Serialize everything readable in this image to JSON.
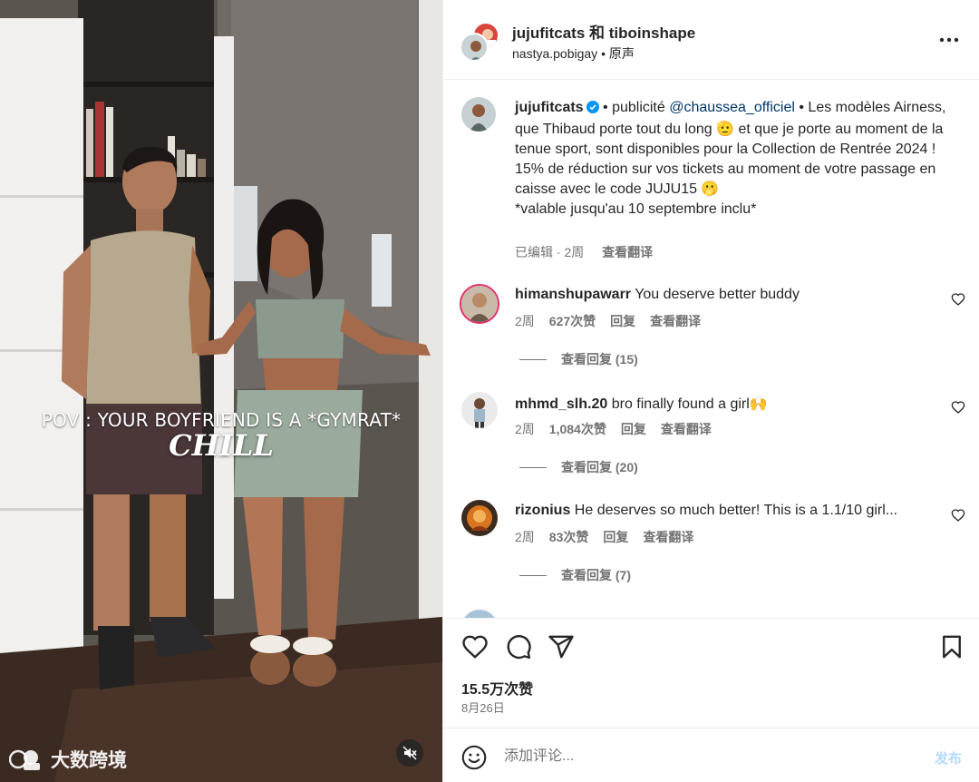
{
  "video": {
    "overlay_text": "POV : YOUR BOYFRIEND IS A *GYMRAT*",
    "overlay_title": "CHILL",
    "mute_icon": "speaker-muted-icon",
    "watermark_text": "大数跨境"
  },
  "header": {
    "user1": "jujufitcats",
    "and": "和",
    "user2": "tiboinshape",
    "audio_user": "nastya.pobigay",
    "audio_sep": " • ",
    "audio_label": "原声",
    "more_icon": "more-horizontal-icon"
  },
  "caption": {
    "username": "jujufitcats",
    "sep": " • ",
    "sponsored": "publicité",
    "mention": "@chaussea_officiel",
    "sep2": " •",
    "line1": "Les modèles Airness, que Thibaud porte tout du long 🫡 et que je porte au moment de la tenue sport, sont disponibles pour la Collection de Rentrée 2024 !",
    "line2": "15% de réduction sur vos tickets au moment de votre passage en caisse avec le code JUJU15 🫢",
    "line3": "*valable jusqu'au 10 septembre inclu*",
    "edited": "已编辑 · 2周",
    "translate": "查看翻译"
  },
  "comments": [
    {
      "username": "himanshupawarr",
      "text": "You deserve better buddy",
      "time": "2周",
      "likes": "627次赞",
      "reply": "回复",
      "translate": "查看翻译",
      "view_replies": "查看回复 (15)"
    },
    {
      "username": "mhmd_slh.20",
      "text": "bro finally found a girl🙌",
      "time": "2周",
      "likes": "1,084次赞",
      "reply": "回复",
      "translate": "查看翻译",
      "view_replies": "查看回复 (20)"
    },
    {
      "username": "rizonius",
      "text": "He deserves so much better! This is a 1.1/10 girl...",
      "time": "2周",
      "likes": "83次赞",
      "reply": "回复",
      "translate": "查看翻译",
      "view_replies": "查看回复 (7)"
    }
  ],
  "actions": {
    "like_icon": "heart-icon",
    "comment_icon": "comment-icon",
    "share_icon": "share-icon",
    "save_icon": "bookmark-icon",
    "likes": "15.5万次赞",
    "date": "8月26日"
  },
  "comment_box": {
    "emoji_icon": "emoji-icon",
    "placeholder": "添加评论...",
    "post_label": "发布"
  },
  "colors": {
    "mention": "#00376b",
    "secondary_text": "#737373",
    "post_disabled": "#b3dbff",
    "verified": "#0095f6"
  }
}
